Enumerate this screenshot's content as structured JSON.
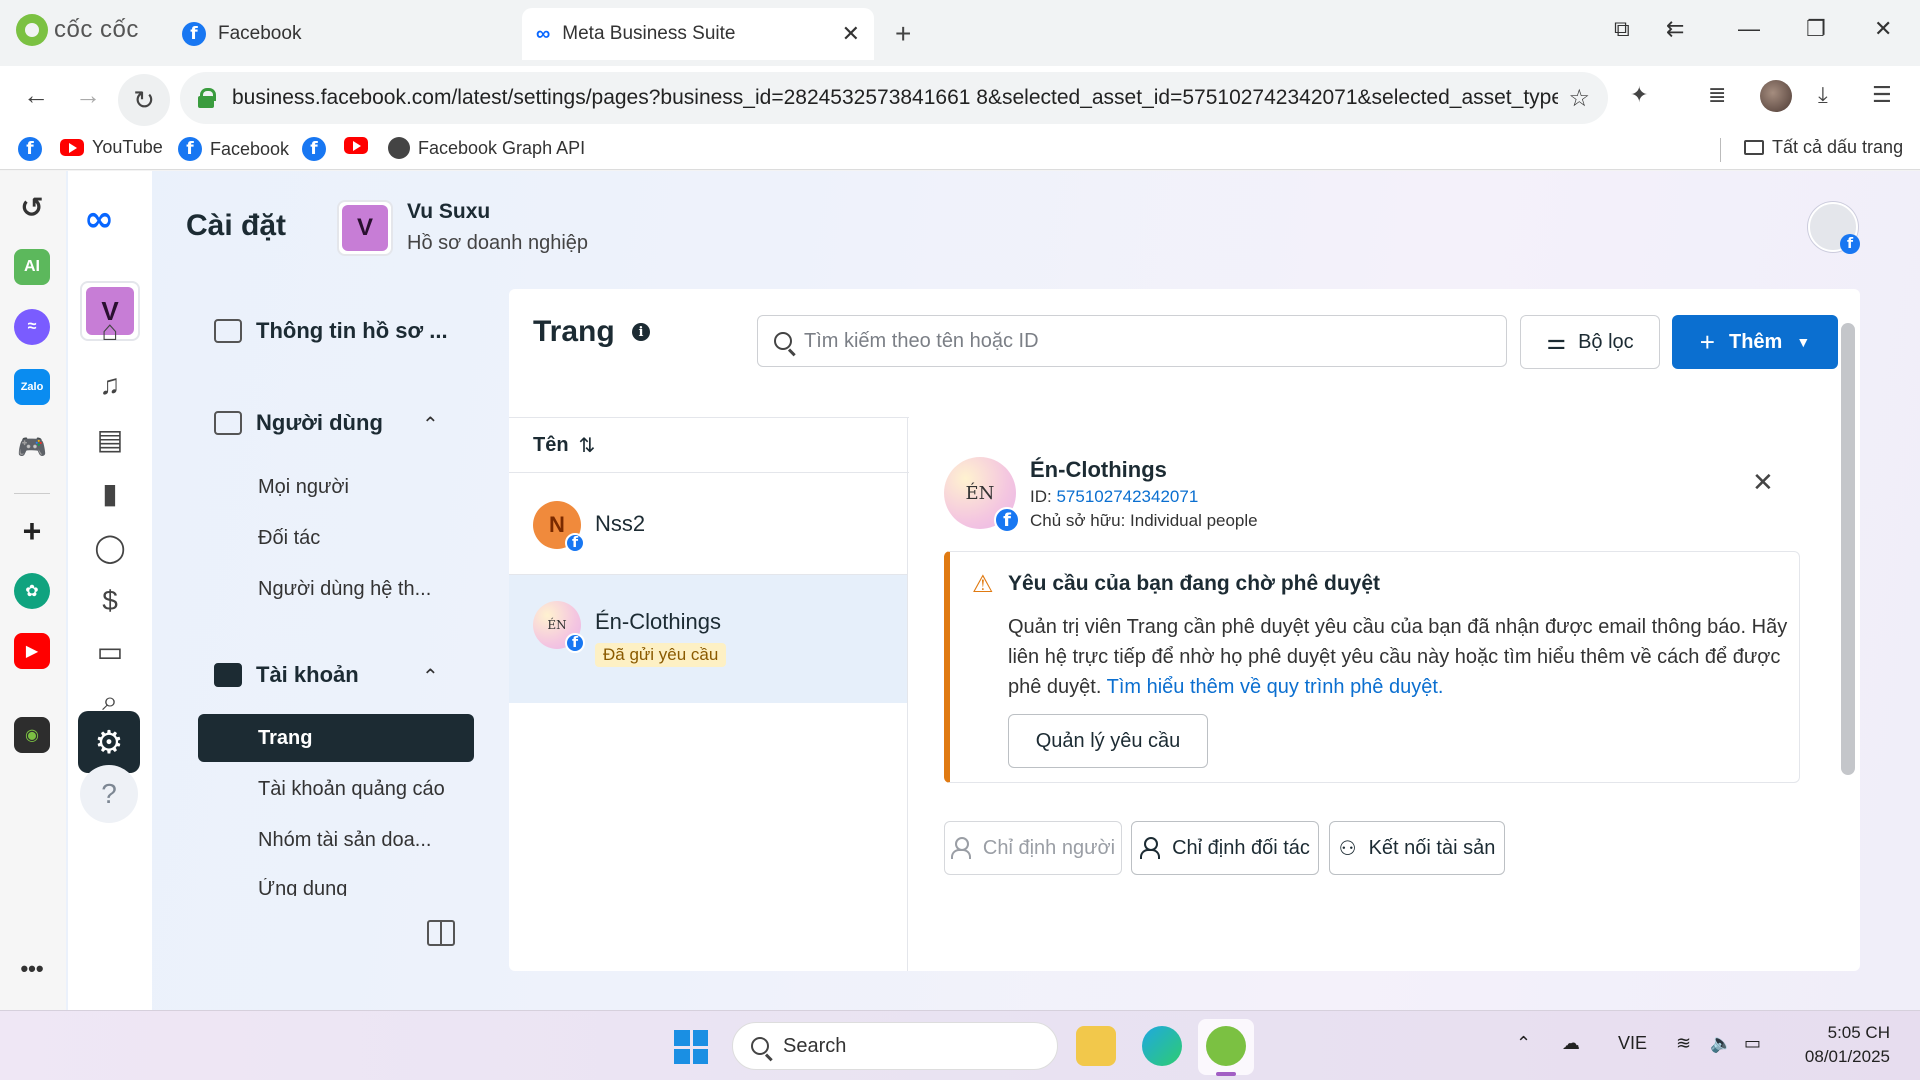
{
  "browser": {
    "brand": "cốc cốc",
    "tabs": [
      {
        "label": "Facebook"
      },
      {
        "label": "Meta Business Suite"
      }
    ],
    "url": "business.facebook.com/latest/settings/pages?business_id=2824532573841661 8&selected_asset_id=575102742342071&selected_asset_type...",
    "bookmarks": [
      "YouTube",
      "Facebook",
      "Facebook Graph API"
    ],
    "all_bookmarks": "Tất cả dấu trang"
  },
  "header": {
    "title": "Cài đặt",
    "business_initial": "V",
    "business_name": "Vu Suxu",
    "business_type": "Hồ sơ doanh nghiệp"
  },
  "settings_nav": {
    "business_info": "Thông tin hồ sơ ...",
    "users_heading": "Người dùng",
    "users_items": [
      "Mọi người",
      "Đối tác",
      "Người dùng hệ th..."
    ],
    "accounts_heading": "Tài khoản",
    "active_item": "Trang",
    "accounts_items": [
      "Tài khoản quảng cáo",
      "Nhóm tài sản doa...",
      "Ứng dụng"
    ]
  },
  "main": {
    "title": "Trang",
    "search_placeholder": "Tìm kiếm theo tên hoặc ID",
    "filter_label": "Bộ lọc",
    "add_label": "Thêm",
    "column_name": "Tên",
    "rows": [
      {
        "initial": "N",
        "name": "Nss2",
        "badge": ""
      },
      {
        "initial": "ÉN",
        "name": "Én-Clothings",
        "badge": "Đã gửi yêu cầu"
      }
    ]
  },
  "detail": {
    "name": "Én-Clothings",
    "id_label": "ID:",
    "id_value": "575102742342071",
    "owner": "Chủ sở hữu: Individual people",
    "alert_title": "Yêu cầu của bạn đang chờ phê duyệt",
    "alert_body": "Quản trị viên Trang cần phê duyệt yêu cầu của bạn đã nhận được email thông báo. Hãy liên hệ trực tiếp để nhờ họ phê duyệt yêu cầu này hoặc tìm hiểu thêm về cách để được phê duyệt.",
    "alert_link": "Tìm hiểu thêm về quy trình phê duyệt.",
    "manage_button": "Quản lý yêu cầu",
    "assign_people": "Chỉ định người",
    "assign_partner": "Chỉ định đối tác",
    "connect_assets": "Kết nối tài sản"
  },
  "taskbar": {
    "search_label": "Search",
    "language": "VIE",
    "time": "5:05 CH",
    "date": "08/01/2025"
  },
  "colors": {
    "meta_blue": "#0866ff",
    "primary_button": "#0b6fd0",
    "nav_active": "#1c2b33",
    "warning": "#e07a12",
    "pending_badge_bg": "#fdf0c4"
  }
}
